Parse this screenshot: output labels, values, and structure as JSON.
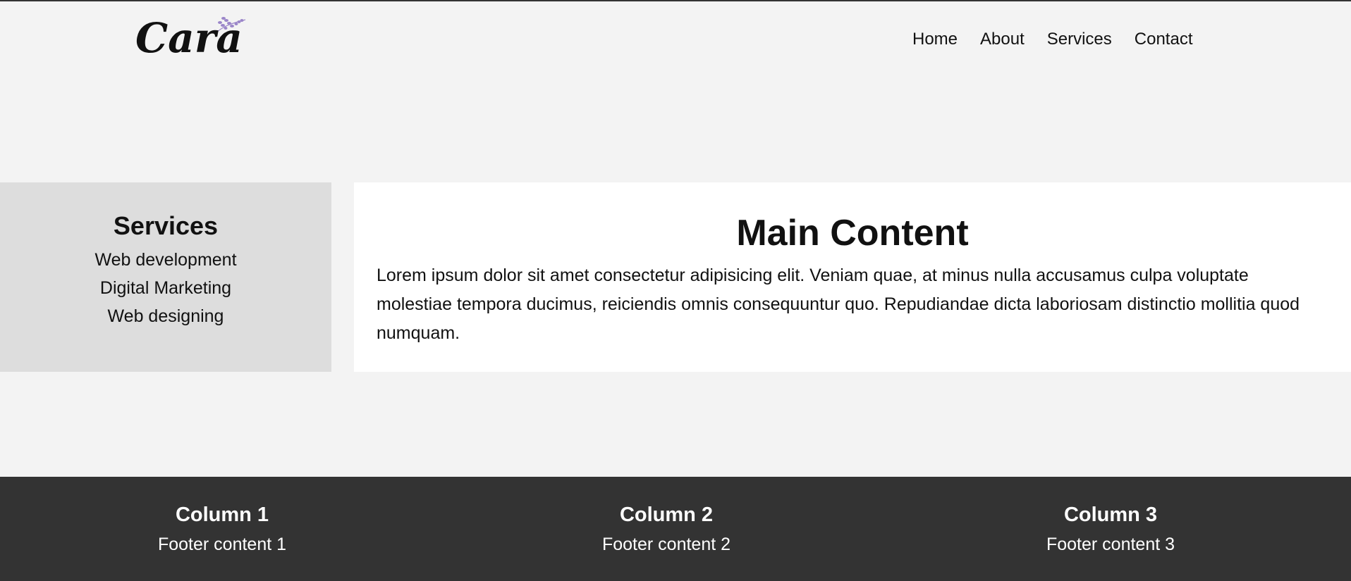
{
  "header": {
    "logo_text": "Cara",
    "nav": [
      "Home",
      "About",
      "Services",
      "Contact"
    ]
  },
  "sidebar": {
    "title": "Services",
    "items": [
      "Web development",
      "Digital Marketing",
      "Web designing"
    ]
  },
  "main": {
    "title": "Main Content",
    "paragraph": "Lorem ipsum dolor sit amet consectetur adipisicing elit. Veniam quae, at minus nulla accusamus culpa voluptate molestiae tempora ducimus, reiciendis omnis consequuntur quo. Repudiandae dicta laboriosam distinctio mollitia quod numquam."
  },
  "footer": {
    "columns": [
      {
        "title": "Column 1",
        "content": "Footer content 1"
      },
      {
        "title": "Column 2",
        "content": "Footer content 2"
      },
      {
        "title": "Column 3",
        "content": "Footer content 3"
      }
    ]
  },
  "colors": {
    "page_background": "#f3f3f3",
    "sidebar_background": "#dddddd",
    "main_background": "#ffffff",
    "footer_background": "#333333",
    "logo_accent": "#9b86c9"
  }
}
